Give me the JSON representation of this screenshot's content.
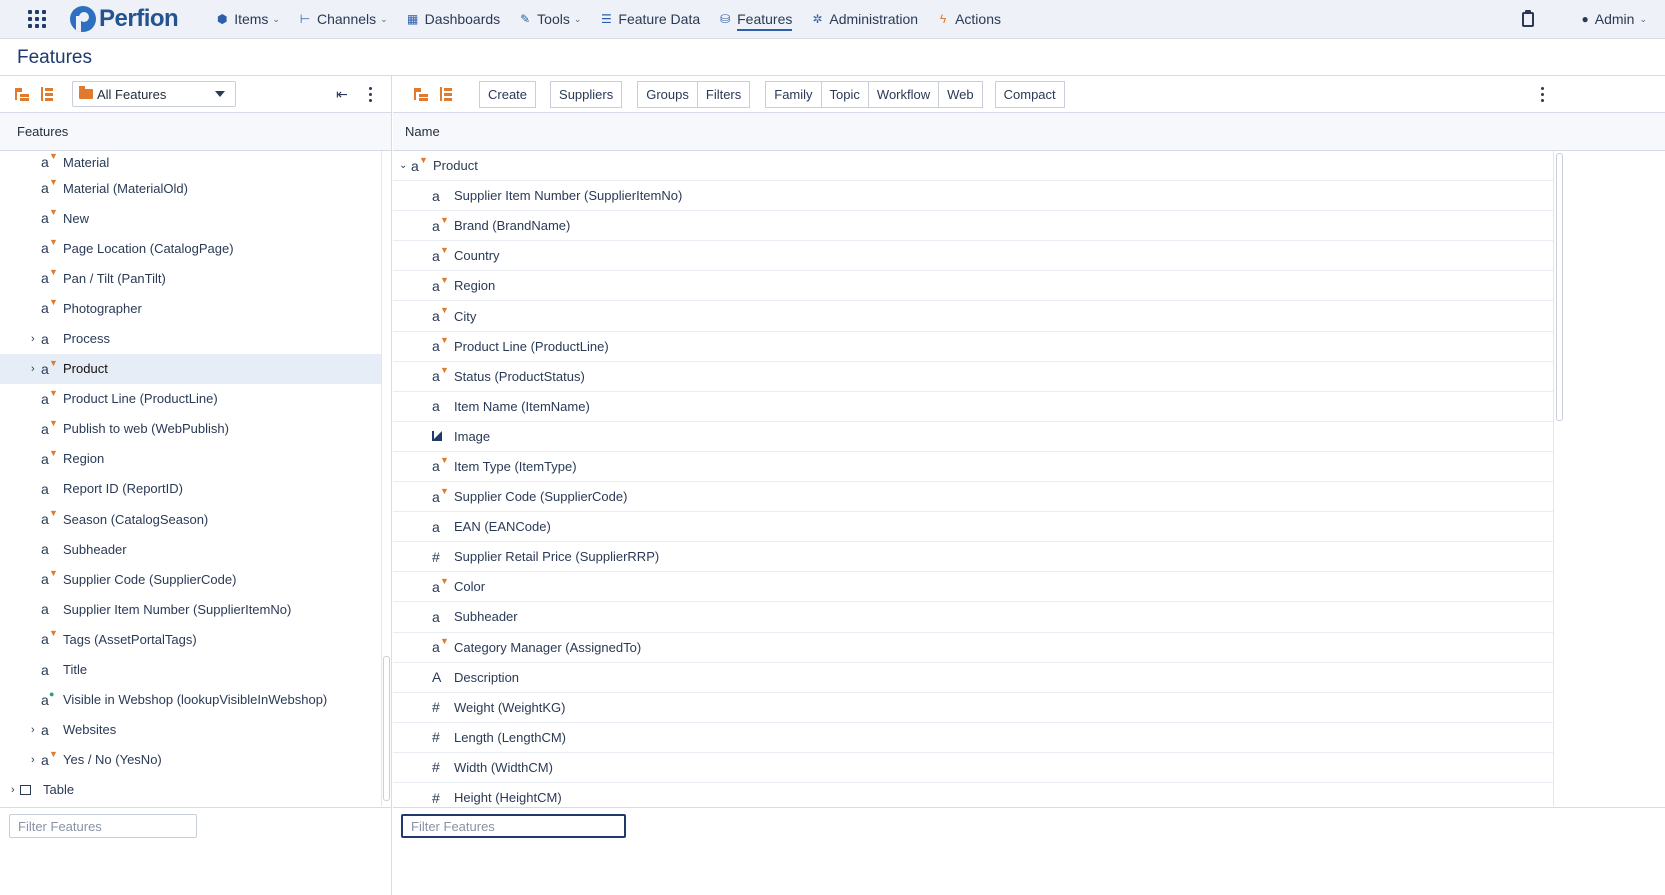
{
  "nav": {
    "logo": "Perfion",
    "items": [
      {
        "label": "Items",
        "icon": "cube-icon",
        "glyph": "⬢",
        "dropdown": true
      },
      {
        "label": "Channels",
        "icon": "channels-icon",
        "glyph": "⊢",
        "dropdown": true
      },
      {
        "label": "Dashboards",
        "icon": "dashboard-icon",
        "glyph": "▦",
        "dropdown": false
      },
      {
        "label": "Tools",
        "icon": "wrench-icon",
        "glyph": "✎",
        "dropdown": true
      },
      {
        "label": "Feature Data",
        "icon": "list-icon",
        "glyph": "☰",
        "dropdown": false
      },
      {
        "label": "Features",
        "icon": "database-icon",
        "glyph": "⛁",
        "dropdown": false,
        "active": true
      },
      {
        "label": "Administration",
        "icon": "gear-icon",
        "glyph": "✲",
        "dropdown": false
      },
      {
        "label": "Actions",
        "icon": "bolt-icon",
        "glyph": "ϟ",
        "dropdown": false
      }
    ],
    "user": "Admin"
  },
  "page": {
    "title": "Features"
  },
  "left": {
    "view_select": "All Features",
    "header": "Features",
    "rows": [
      {
        "label": "Material",
        "type": "sel",
        "expand": false
      },
      {
        "label": "Material (MaterialOld)",
        "type": "sel",
        "expand": false
      },
      {
        "label": "New",
        "type": "sel",
        "expand": false
      },
      {
        "label": "Page Location (CatalogPage)",
        "type": "sel",
        "expand": false
      },
      {
        "label": "Pan / Tilt (PanTilt)",
        "type": "sel",
        "expand": false
      },
      {
        "label": "Photographer",
        "type": "sel",
        "expand": false
      },
      {
        "label": "Process",
        "type": "text",
        "expand": true
      },
      {
        "label": "Product",
        "type": "sel",
        "expand": true,
        "selected": true
      },
      {
        "label": "Product Line (ProductLine)",
        "type": "sel",
        "expand": false
      },
      {
        "label": "Publish to web (WebPublish)",
        "type": "sel",
        "expand": false
      },
      {
        "label": "Region",
        "type": "sel",
        "expand": false
      },
      {
        "label": "Report ID (ReportID)",
        "type": "text",
        "expand": false
      },
      {
        "label": "Season (CatalogSeason)",
        "type": "sel",
        "expand": false
      },
      {
        "label": "Subheader",
        "type": "text",
        "expand": false
      },
      {
        "label": "Supplier Code (SupplierCode)",
        "type": "sel",
        "expand": false
      },
      {
        "label": "Supplier Item Number (SupplierItemNo)",
        "type": "text",
        "expand": false
      },
      {
        "label": "Tags (AssetPortalTags)",
        "type": "sel",
        "expand": false
      },
      {
        "label": "Title",
        "type": "text",
        "expand": false
      },
      {
        "label": "Visible in Webshop (lookupVisibleInWebshop)",
        "type": "lookup",
        "expand": false
      },
      {
        "label": "Websites",
        "type": "text",
        "expand": true
      },
      {
        "label": "Yes / No (YesNo)",
        "type": "sel",
        "expand": true
      }
    ],
    "table_row": "Table",
    "filter_placeholder": "Filter Features"
  },
  "right": {
    "buttons": {
      "create": "Create",
      "suppliers": "Suppliers",
      "groups": "Groups",
      "filters": "Filters",
      "family": "Family",
      "topic": "Topic",
      "workflow": "Workflow",
      "web": "Web",
      "compact": "Compact"
    },
    "column_header": "Name",
    "root": "Product",
    "rows": [
      {
        "label": "Supplier Item Number (SupplierItemNo)",
        "type": "text"
      },
      {
        "label": "Brand (BrandName)",
        "type": "sel"
      },
      {
        "label": "Country",
        "type": "sel"
      },
      {
        "label": "Region",
        "type": "sel"
      },
      {
        "label": "City",
        "type": "sel"
      },
      {
        "label": "Product Line (ProductLine)",
        "type": "sel"
      },
      {
        "label": "Status (ProductStatus)",
        "type": "sel"
      },
      {
        "label": "Item Name (ItemName)",
        "type": "text"
      },
      {
        "label": "Image",
        "type": "image"
      },
      {
        "label": "Item Type (ItemType)",
        "type": "sel"
      },
      {
        "label": "Supplier Code (SupplierCode)",
        "type": "sel"
      },
      {
        "label": "EAN (EANCode)",
        "type": "text"
      },
      {
        "label": "Supplier Retail Price (SupplierRRP)",
        "type": "number"
      },
      {
        "label": "Color",
        "type": "sel"
      },
      {
        "label": "Subheader",
        "type": "text"
      },
      {
        "label": "Category Manager (AssignedTo)",
        "type": "sel"
      },
      {
        "label": "Description",
        "type": "richtext"
      },
      {
        "label": "Weight (WeightKG)",
        "type": "number"
      },
      {
        "label": "Length (LengthCM)",
        "type": "number"
      },
      {
        "label": "Width (WidthCM)",
        "type": "number"
      },
      {
        "label": "Height (HeightCM)",
        "type": "number"
      }
    ],
    "filter_placeholder": "Filter Features"
  },
  "colors": {
    "accent": "#2e5fa8",
    "orange": "#e07a2e",
    "lookup_green": "#2aa36b"
  }
}
